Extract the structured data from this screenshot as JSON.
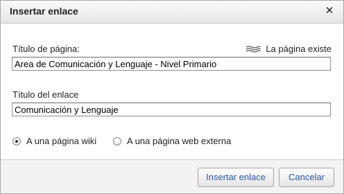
{
  "dialog": {
    "title": "Insertar enlace",
    "close_icon": "close-icon"
  },
  "page_title": {
    "label": "Título de página:",
    "value": "Area de Comunicación y Lenguaje - Nivel Primario",
    "status_text": "La página existe",
    "status_icon": "page-exists-icon"
  },
  "link_title": {
    "label": "Título del enlace",
    "value": "Comunicación y Lenguaje"
  },
  "link_type": {
    "options": [
      {
        "label": "A una página wiki",
        "checked": true
      },
      {
        "label": "A una página web externa",
        "checked": false
      }
    ]
  },
  "buttons": {
    "insert_label": "Insertar enlace",
    "cancel_label": "Cancelar"
  }
}
